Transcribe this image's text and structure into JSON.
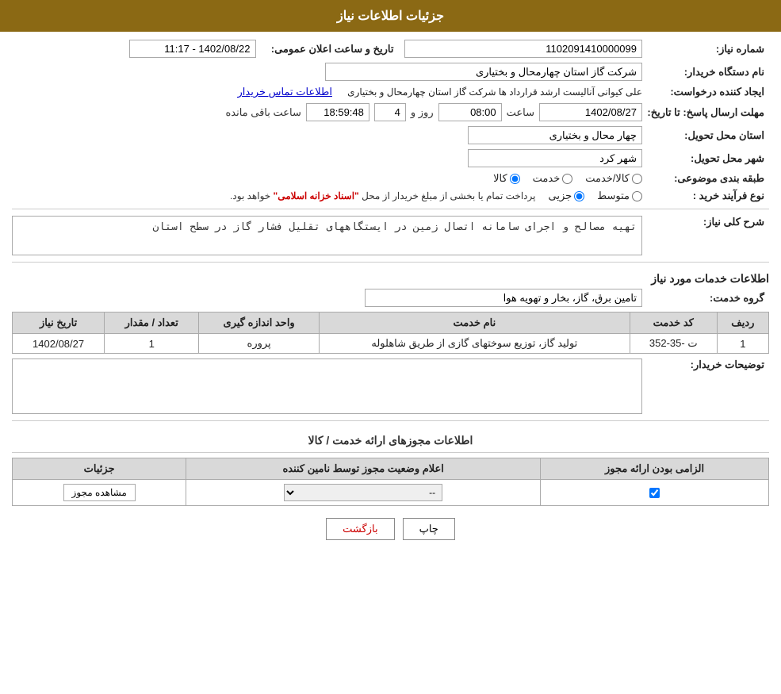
{
  "header": {
    "title": "جزئیات اطلاعات نیاز"
  },
  "fields": {
    "need_number_label": "شماره نیاز:",
    "need_number_value": "1102091410000099",
    "buyer_org_label": "نام دستگاه خریدار:",
    "buyer_org_value": "شرکت گاز استان چهارمحال و بختیاری",
    "created_by_label": "ایجاد کننده درخواست:",
    "created_by_value": "علی کیوانی آنالیست ارشد قرارداد ها شرکت گاز استان چهارمحال و بختیاری",
    "contact_link": "اطلاعات تماس خریدار",
    "response_deadline_label": "مهلت ارسال پاسخ: تا تاریخ:",
    "response_date": "1402/08/27",
    "response_time_label": "ساعت",
    "response_time": "08:00",
    "days_label": "روز و",
    "days_value": "4",
    "countdown_value": "18:59:48",
    "remaining_label": "ساعت باقی مانده",
    "delivery_province_label": "استان محل تحویل:",
    "delivery_province_value": "چهار محال و بختیاری",
    "delivery_city_label": "شهر محل تحویل:",
    "delivery_city_value": "شهر کرد",
    "category_label": "طبقه بندی موضوعی:",
    "category_goods": "کالا",
    "category_service": "خدمت",
    "category_goods_service": "کالا/خدمت",
    "purchase_type_label": "نوع فرآیند خرید :",
    "purchase_type_partial": "جزیی",
    "purchase_type_medium": "متوسط",
    "purchase_type_notice": "پرداخت تمام یا بخشی از مبلغ خریدار از محل",
    "purchase_type_highlight": "\"اسناد خزانه اسلامی\"",
    "purchase_type_suffix": "خواهد بود.",
    "announcement_label": "تاریخ و ساعت اعلان عمومی:",
    "announcement_value": "1402/08/22 - 11:17",
    "need_description_label": "شرح کلی نیاز:",
    "need_description_value": "تهیه مصالح و اجرای سامانه اتصال زمین در ایستگاههای تقلیل فشار گاز در سطح استان",
    "services_section_title": "اطلاعات خدمات مورد نیاز",
    "service_group_label": "گروه خدمت:",
    "service_group_value": "تامین برق، گاز، بخار و تهویه هوا",
    "table": {
      "headers": [
        "ردیف",
        "کد خدمت",
        "نام خدمت",
        "واحد اندازه گیری",
        "تعداد / مقدار",
        "تاریخ نیاز"
      ],
      "rows": [
        {
          "row": "1",
          "code": "ت -35-352",
          "name": "تولید گاز، توزیع سوختهای گازی از طریق شاهلوله",
          "unit": "پروره",
          "quantity": "1",
          "date": "1402/08/27"
        }
      ]
    },
    "buyer_notes_label": "توضیحات خریدار:",
    "buyer_notes_value": ""
  },
  "permissions": {
    "section_title": "اطلاعات مجوزهای ارائه خدمت / کالا",
    "table": {
      "headers": [
        "الزامی بودن ارائه مجوز",
        "اعلام وضعیت مجوز توسط نامین کننده",
        "جزئیات"
      ],
      "rows": [
        {
          "required": true,
          "status_value": "--",
          "details_label": "مشاهده مجوز"
        }
      ]
    }
  },
  "buttons": {
    "print": "چاپ",
    "back": "بازگشت"
  }
}
